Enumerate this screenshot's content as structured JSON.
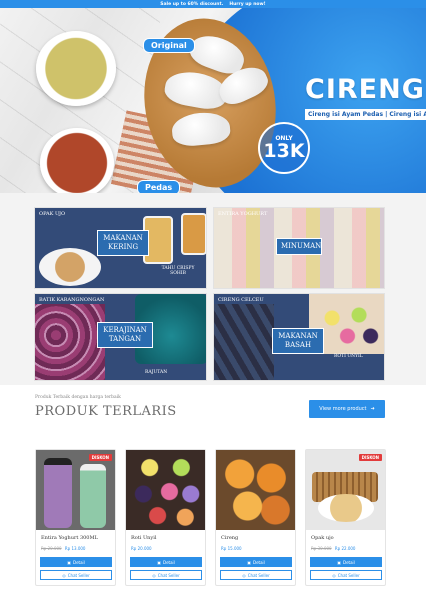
{
  "topbar": {
    "text": "Sale up to 60% discount.",
    "cta": "Hurry up now!"
  },
  "hero": {
    "title": "CIRENG",
    "subtitle": "Cireng isi Ayam Pedas | Cireng isi Ay",
    "badge_top": "ONLY",
    "badge_price": "13K",
    "label_original": "Original",
    "label_pedas": "Pedas",
    "colors": {
      "blue": "#2b8fe8"
    }
  },
  "categories": [
    {
      "name": "OPAK UJO",
      "label_line1": "MAKANAN",
      "label_line2": "KERING",
      "note": "TAHU CRISPY SOHIB"
    },
    {
      "name": "ENTIRA YOGHURT",
      "label_line1": "MINUMAN",
      "label_line2": "",
      "note": ""
    },
    {
      "name": "BATIK KARANGNONGAN",
      "label_line1": "KERAJINAN",
      "label_line2": "TANGAN",
      "note": "RAJUTAN"
    },
    {
      "name": "CIRENG CELCEU",
      "label_line1": "MAKANAN",
      "label_line2": "BASAH",
      "note": "ROTI UNYIL"
    }
  ],
  "products_section": {
    "tagline": "Produk Terbaik dengan harga terbaik",
    "title": "PRODUK TERLARIS",
    "view_more": "View more product"
  },
  "products": [
    {
      "name": "Entira Yoghurt 300ML",
      "old_price": "Rp 20.000",
      "price": "Rp 13.000",
      "discount": "DISKON",
      "detail": "Detail",
      "chat": "Chat Seller"
    },
    {
      "name": "Roti Unyil",
      "old_price": "",
      "price": "Rp 20.000",
      "discount": "",
      "detail": "Detail",
      "chat": "Chat Seller"
    },
    {
      "name": "Cireng",
      "old_price": "",
      "price": "Rp 15.000",
      "discount": "",
      "detail": "Detail",
      "chat": "Chat Seller"
    },
    {
      "name": "Opak ujo",
      "old_price": "Rp 30.000",
      "price": "Rp 22.000",
      "discount": "DISKON",
      "detail": "Detail",
      "chat": "Chat Seller"
    }
  ]
}
